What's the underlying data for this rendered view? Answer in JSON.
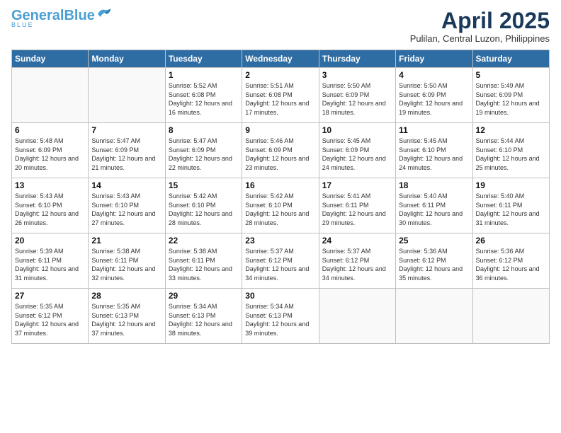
{
  "logo": {
    "line1": "General",
    "line2": "Blue"
  },
  "title": "April 2025",
  "subtitle": "Pulilan, Central Luzon, Philippines",
  "days_of_week": [
    "Sunday",
    "Monday",
    "Tuesday",
    "Wednesday",
    "Thursday",
    "Friday",
    "Saturday"
  ],
  "weeks": [
    [
      {
        "day": "",
        "info": ""
      },
      {
        "day": "",
        "info": ""
      },
      {
        "day": "1",
        "sunrise": "5:52 AM",
        "sunset": "6:08 PM",
        "daylight": "12 hours and 16 minutes."
      },
      {
        "day": "2",
        "sunrise": "5:51 AM",
        "sunset": "6:08 PM",
        "daylight": "12 hours and 17 minutes."
      },
      {
        "day": "3",
        "sunrise": "5:50 AM",
        "sunset": "6:09 PM",
        "daylight": "12 hours and 18 minutes."
      },
      {
        "day": "4",
        "sunrise": "5:50 AM",
        "sunset": "6:09 PM",
        "daylight": "12 hours and 19 minutes."
      },
      {
        "day": "5",
        "sunrise": "5:49 AM",
        "sunset": "6:09 PM",
        "daylight": "12 hours and 19 minutes."
      }
    ],
    [
      {
        "day": "6",
        "sunrise": "5:48 AM",
        "sunset": "6:09 PM",
        "daylight": "12 hours and 20 minutes."
      },
      {
        "day": "7",
        "sunrise": "5:47 AM",
        "sunset": "6:09 PM",
        "daylight": "12 hours and 21 minutes."
      },
      {
        "day": "8",
        "sunrise": "5:47 AM",
        "sunset": "6:09 PM",
        "daylight": "12 hours and 22 minutes."
      },
      {
        "day": "9",
        "sunrise": "5:46 AM",
        "sunset": "6:09 PM",
        "daylight": "12 hours and 23 minutes."
      },
      {
        "day": "10",
        "sunrise": "5:45 AM",
        "sunset": "6:09 PM",
        "daylight": "12 hours and 24 minutes."
      },
      {
        "day": "11",
        "sunrise": "5:45 AM",
        "sunset": "6:10 PM",
        "daylight": "12 hours and 24 minutes."
      },
      {
        "day": "12",
        "sunrise": "5:44 AM",
        "sunset": "6:10 PM",
        "daylight": "12 hours and 25 minutes."
      }
    ],
    [
      {
        "day": "13",
        "sunrise": "5:43 AM",
        "sunset": "6:10 PM",
        "daylight": "12 hours and 26 minutes."
      },
      {
        "day": "14",
        "sunrise": "5:43 AM",
        "sunset": "6:10 PM",
        "daylight": "12 hours and 27 minutes."
      },
      {
        "day": "15",
        "sunrise": "5:42 AM",
        "sunset": "6:10 PM",
        "daylight": "12 hours and 28 minutes."
      },
      {
        "day": "16",
        "sunrise": "5:42 AM",
        "sunset": "6:10 PM",
        "daylight": "12 hours and 28 minutes."
      },
      {
        "day": "17",
        "sunrise": "5:41 AM",
        "sunset": "6:11 PM",
        "daylight": "12 hours and 29 minutes."
      },
      {
        "day": "18",
        "sunrise": "5:40 AM",
        "sunset": "6:11 PM",
        "daylight": "12 hours and 30 minutes."
      },
      {
        "day": "19",
        "sunrise": "5:40 AM",
        "sunset": "6:11 PM",
        "daylight": "12 hours and 31 minutes."
      }
    ],
    [
      {
        "day": "20",
        "sunrise": "5:39 AM",
        "sunset": "6:11 PM",
        "daylight": "12 hours and 31 minutes."
      },
      {
        "day": "21",
        "sunrise": "5:38 AM",
        "sunset": "6:11 PM",
        "daylight": "12 hours and 32 minutes."
      },
      {
        "day": "22",
        "sunrise": "5:38 AM",
        "sunset": "6:11 PM",
        "daylight": "12 hours and 33 minutes."
      },
      {
        "day": "23",
        "sunrise": "5:37 AM",
        "sunset": "6:12 PM",
        "daylight": "12 hours and 34 minutes."
      },
      {
        "day": "24",
        "sunrise": "5:37 AM",
        "sunset": "6:12 PM",
        "daylight": "12 hours and 34 minutes."
      },
      {
        "day": "25",
        "sunrise": "5:36 AM",
        "sunset": "6:12 PM",
        "daylight": "12 hours and 35 minutes."
      },
      {
        "day": "26",
        "sunrise": "5:36 AM",
        "sunset": "6:12 PM",
        "daylight": "12 hours and 36 minutes."
      }
    ],
    [
      {
        "day": "27",
        "sunrise": "5:35 AM",
        "sunset": "6:12 PM",
        "daylight": "12 hours and 37 minutes."
      },
      {
        "day": "28",
        "sunrise": "5:35 AM",
        "sunset": "6:13 PM",
        "daylight": "12 hours and 37 minutes."
      },
      {
        "day": "29",
        "sunrise": "5:34 AM",
        "sunset": "6:13 PM",
        "daylight": "12 hours and 38 minutes."
      },
      {
        "day": "30",
        "sunrise": "5:34 AM",
        "sunset": "6:13 PM",
        "daylight": "12 hours and 39 minutes."
      },
      {
        "day": "",
        "info": ""
      },
      {
        "day": "",
        "info": ""
      },
      {
        "day": "",
        "info": ""
      }
    ]
  ]
}
